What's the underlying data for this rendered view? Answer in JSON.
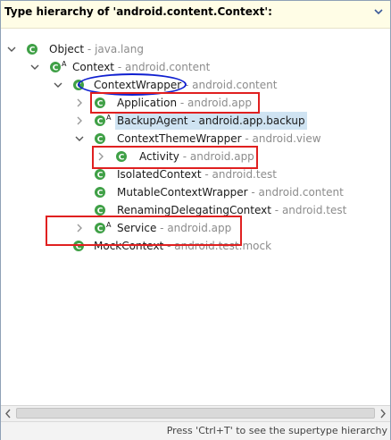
{
  "header": {
    "title": "Type hierarchy of 'android.content.Context':"
  },
  "tree": {
    "separator": " - ",
    "rows": [
      {
        "name": "Object",
        "pkg": "java.lang"
      },
      {
        "name": "Context",
        "pkg": "android.content"
      },
      {
        "name": "ContextWrapper",
        "pkg": "android.content"
      },
      {
        "name": "Application",
        "pkg": "android.app"
      },
      {
        "name": "BackupAgent",
        "pkg": "android.app.backup"
      },
      {
        "name": "ContextThemeWrapper",
        "pkg": "android.view"
      },
      {
        "name": "Activity",
        "pkg": "android.app"
      },
      {
        "name": "IsolatedContext",
        "pkg": "android.test"
      },
      {
        "name": "MutableContextWrapper",
        "pkg": "android.content"
      },
      {
        "name": "RenamingDelegatingContext",
        "pkg": "android.test"
      },
      {
        "name": "Service",
        "pkg": "android.app"
      },
      {
        "name": "MockContext",
        "pkg": "android.test.mock"
      }
    ]
  },
  "status": {
    "text": "Press 'Ctrl+T' to see the supertype hierarchy"
  },
  "colors": {
    "class_icon": "#3fa046",
    "package_text": "#8c8c8c",
    "annotation_red": "#e02020",
    "annotation_blue": "#1020d0",
    "selection": "#cfe3f2"
  }
}
